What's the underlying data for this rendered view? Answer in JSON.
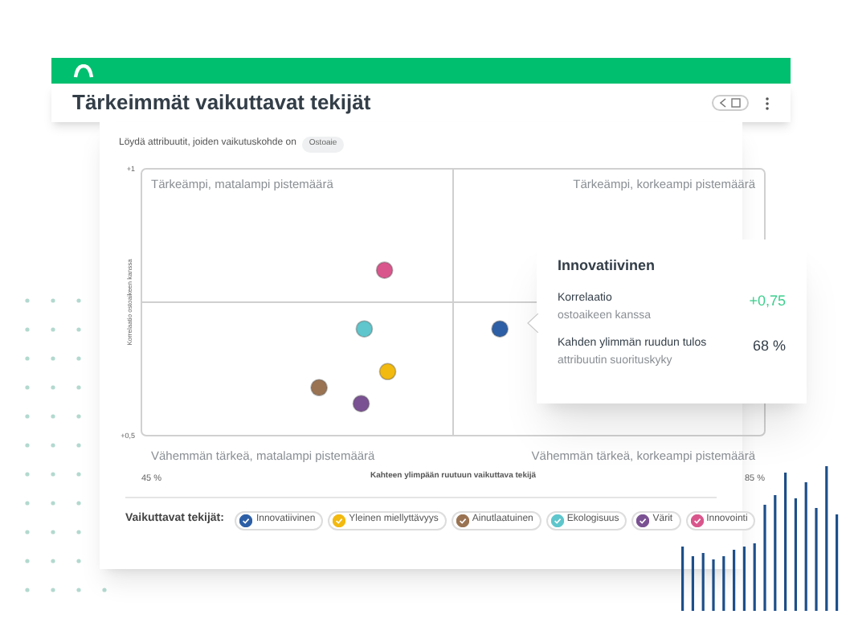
{
  "window": {
    "title": "Tärkeimmät vaikuttavat tekijät"
  },
  "filter": {
    "label": "Löydä attribuutit, joiden vaikutuskohde on",
    "chip": "Ostoaie"
  },
  "chart_data": {
    "type": "scatter",
    "xlabel": "Kahteen ylimpään ruutuun vaikuttava tekijä",
    "ylabel": "Korrelaatio ostoaikeen kanssa",
    "xlim": [
      45,
      85
    ],
    "ylim": [
      0.5,
      1
    ],
    "xticks": [
      {
        "value": 45,
        "label": "45 %"
      },
      {
        "value": 85,
        "label": "85 %"
      }
    ],
    "yticks": [
      {
        "value": 1,
        "label": "+1"
      },
      {
        "value": 0.5,
        "label": "+0,5"
      }
    ],
    "ref_lines": [
      {
        "axis": "x",
        "value": 65
      },
      {
        "axis": "y",
        "value": 0.75
      }
    ],
    "annotations": [
      {
        "text": "Tärkeämpi, matalampi pistemäärä"
      },
      {
        "text": "Tärkeämpi, korkeampi pistemäärä"
      },
      {
        "text": "Vähemmän tärkeä, matalampi pistemäärä"
      },
      {
        "text": "Vähemmän tärkeä, korkeampi pistemäärä"
      }
    ],
    "series": [
      {
        "name": "Innovatiivinen",
        "color": "#2d5fa6",
        "x": [
          68
        ],
        "values": [
          0.7
        ]
      },
      {
        "name": "Yleinen miellyttävyys",
        "color": "#f2b90f",
        "x": [
          60.8
        ],
        "values": [
          0.62
        ]
      },
      {
        "name": "Ainutlaatuinen",
        "color": "#9a7352",
        "x": [
          56.4
        ],
        "values": [
          0.59
        ]
      },
      {
        "name": "Ekologisuus",
        "color": "#5ec6cc",
        "x": [
          59.3
        ],
        "values": [
          0.7
        ]
      },
      {
        "name": "Värit",
        "color": "#7a5193",
        "x": [
          59.1
        ],
        "values": [
          0.56
        ]
      },
      {
        "name": "Innovointi",
        "color": "#d9568c",
        "x": [
          60.6
        ],
        "values": [
          0.81
        ]
      }
    ]
  },
  "legend": {
    "label": "Vaikuttavat tekijät:",
    "items": [
      {
        "checked": true
      },
      {
        "checked": true
      },
      {
        "checked": true
      },
      {
        "checked": true
      },
      {
        "checked": true
      },
      {
        "checked": true
      }
    ]
  },
  "tooltip": {
    "title": "Innovatiivinen",
    "rows": [
      {
        "kind": "positive",
        "label": "Korrelaatio",
        "sublabel": "ostoaikeen kanssa",
        "value": "+0,75"
      },
      {
        "kind": "neutral",
        "label": "Kahden ylimmän ruudun tulos",
        "sublabel": "attribuutin suorituskyky",
        "value": "68 %"
      }
    ]
  }
}
